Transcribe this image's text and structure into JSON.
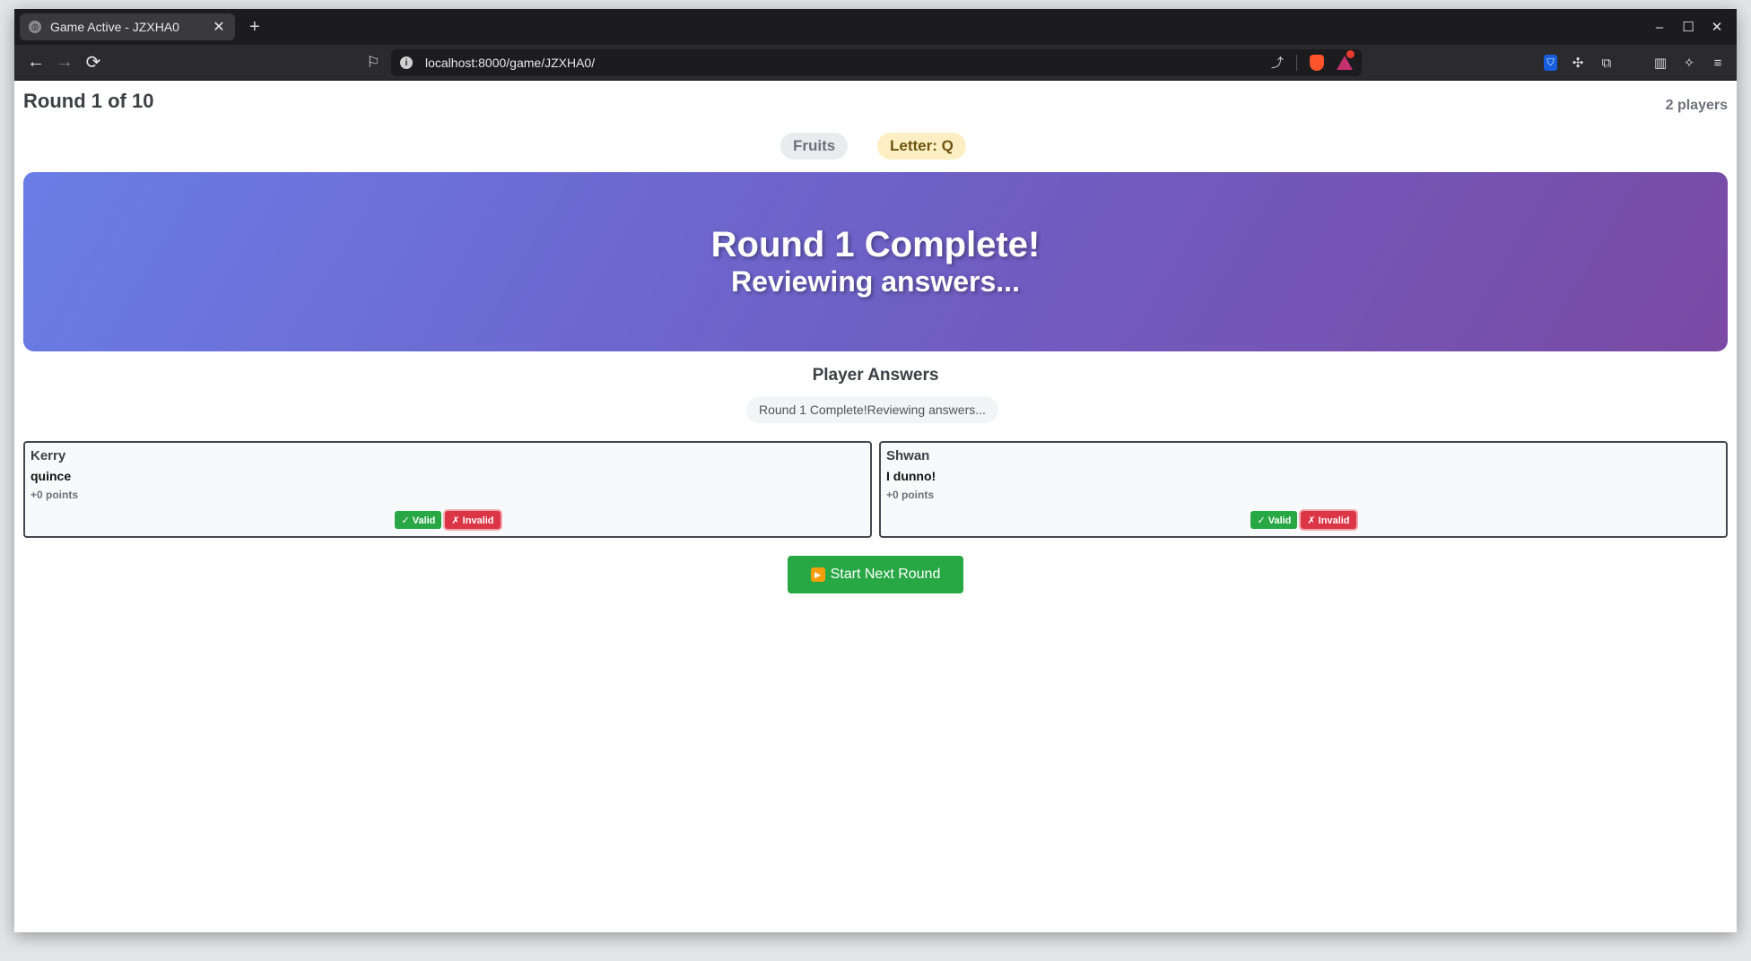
{
  "browser": {
    "tab_title": "Game Active - JZXHA0",
    "url": "localhost:8000/game/JZXHA0/",
    "icons": {
      "back": "←",
      "forward": "→",
      "reload": "⟳",
      "bookmark": "⚐",
      "info": "i",
      "share": "⤴",
      "tab_close": "✕",
      "new_tab": "+",
      "minimize": "–",
      "maximize": "☐",
      "close": "✕",
      "bitwarden": "⛉",
      "extensions": "✣",
      "screenshot": "⧉",
      "sidebar": "▥",
      "leo": "✧",
      "menu": "≡"
    }
  },
  "game": {
    "round_title": "Round 1 of 10",
    "player_count": "2 players",
    "category": "Fruits",
    "letter": "Letter: Q",
    "banner_line1": "Round 1 Complete!",
    "banner_line2": "Reviewing answers...",
    "answers_heading": "Player Answers",
    "status_text": "Round 1 Complete!Reviewing answers...",
    "players": [
      {
        "name": "Kerry",
        "answer": "quince",
        "points": "+0 points",
        "valid_label": "✓ Valid",
        "invalid_label": "✗ Invalid"
      },
      {
        "name": "Shwan",
        "answer": "I dunno!",
        "points": "+0 points",
        "valid_label": "✓ Valid",
        "invalid_label": "✗ Invalid"
      }
    ],
    "next_round_label": "Start Next Round",
    "next_round_icon": "▶"
  },
  "colors": {
    "banner_start": "#6a7de6",
    "banner_end": "#7a4aa4",
    "valid": "#28a745",
    "invalid": "#dc3545",
    "next_round": "#28a745"
  }
}
